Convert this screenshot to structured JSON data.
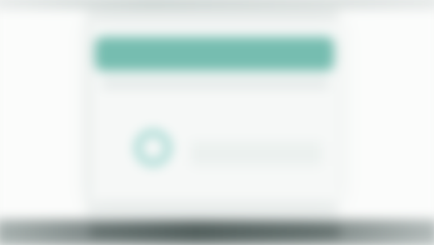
{
  "colors": {
    "background": "#f3f5f4",
    "dialog_background": "#f6f8f7",
    "header_teal": "#76bdb0",
    "spinner_teal": "#6ec4b9",
    "bottom_bar": "#5f6b69"
  },
  "icons": {
    "loading_indicator": "spinner-icon"
  }
}
